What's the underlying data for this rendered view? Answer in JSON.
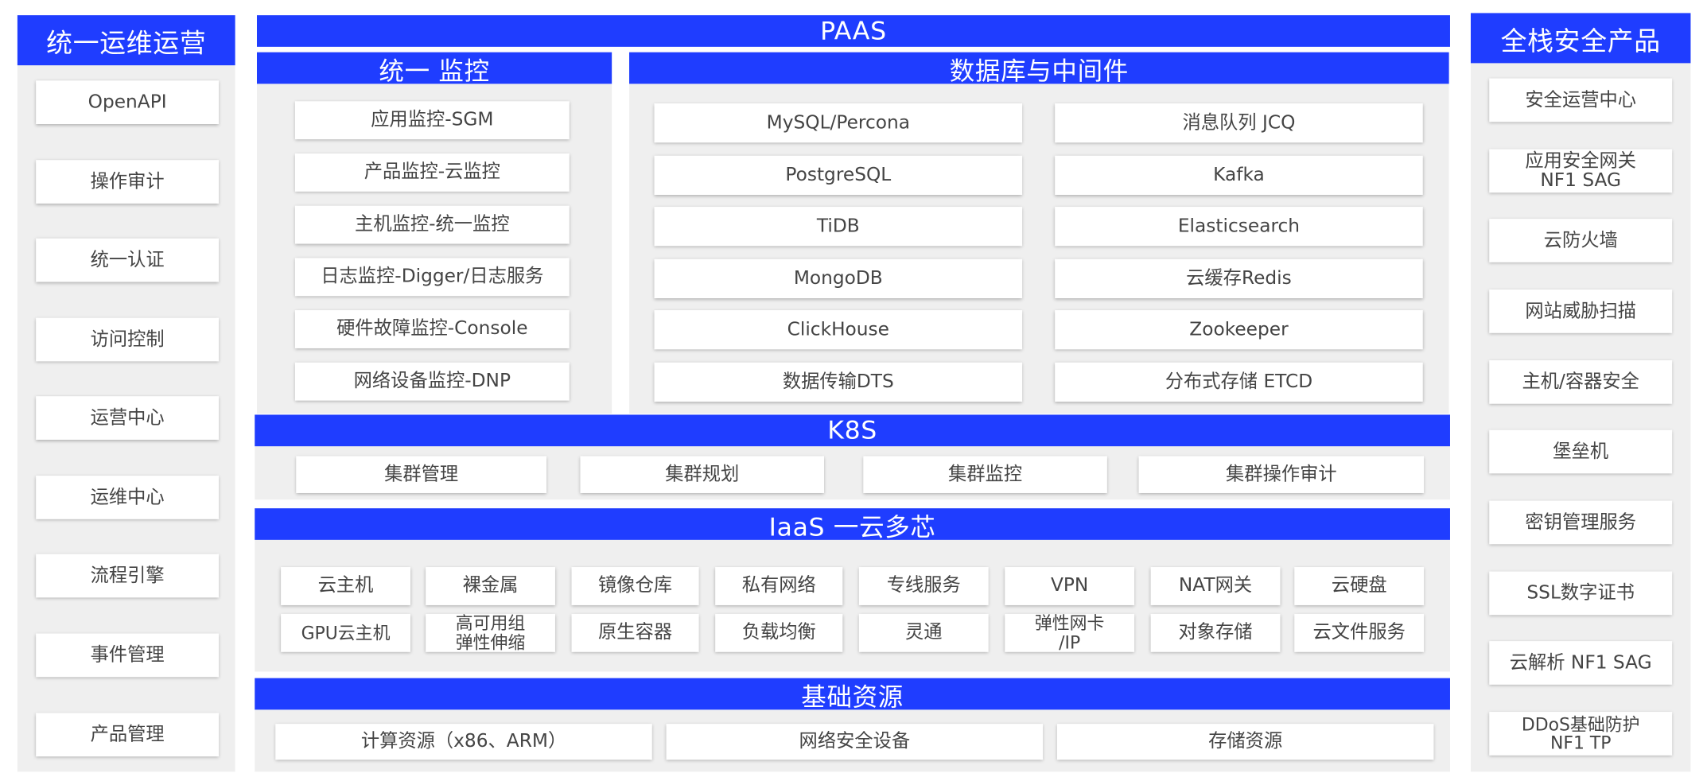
{
  "left": {
    "title": "统一运维运营",
    "items": [
      "OpenAPI",
      "操作审计",
      "统一认证",
      "访问控制",
      "运营中心",
      "运维中心",
      "流程引擎",
      "事件管理",
      "产品管理"
    ]
  },
  "right": {
    "title": "全栈安全产品",
    "items": [
      "安全运营中心",
      "应用安全网关\nNF1 SAG",
      "云防火墙",
      "网站威胁扫描",
      "主机/容器安全",
      "堡垒机",
      "密钥管理服务",
      "SSL数字证书",
      "云解析 NF1 SAG",
      "DDoS基础防护\nNF1 TP"
    ]
  },
  "paas": {
    "title": "PAAS",
    "monitor": {
      "title": "统一 监控",
      "items": [
        "应用监控-SGM",
        "产品监控-云监控",
        "主机监控-统一监控",
        "日志监控-Digger/日志服务",
        "硬件故障监控-Console",
        "网络设备监控-DNP"
      ]
    },
    "db": {
      "title": "数据库与中间件",
      "left_items": [
        "MySQL/Percona",
        "PostgreSQL",
        "TiDB",
        "MongoDB",
        "ClickHouse",
        "数据传输DTS"
      ],
      "right_items": [
        "消息队列 JCQ",
        "Kafka",
        "Elasticsearch",
        "云缓存Redis",
        "Zookeeper",
        "分布式存储 ETCD"
      ]
    }
  },
  "k8s": {
    "title": "K8S",
    "items": [
      "集群管理",
      "集群规划",
      "集群监控",
      "集群操作审计"
    ]
  },
  "iaas": {
    "title": "IaaS 一云多芯",
    "row1": [
      "云主机",
      "裸金属",
      "镜像仓库",
      "私有网络",
      "专线服务",
      "VPN",
      "NAT网关",
      "云硬盘"
    ],
    "row2": [
      "GPU云主机",
      "高可用组\n弹性伸缩",
      "原生容器",
      "负载均衡",
      "灵通",
      "弹性网卡\n/IP",
      "对象存储",
      "云文件服务"
    ]
  },
  "base": {
    "title": "基础资源",
    "items": [
      "计算资源（x86、ARM）",
      "网络安全设备",
      "存储资源"
    ]
  },
  "colors": {
    "header_blue": "#1f3dff",
    "panel_grey": "#efefef",
    "box_white": "#ffffff"
  }
}
